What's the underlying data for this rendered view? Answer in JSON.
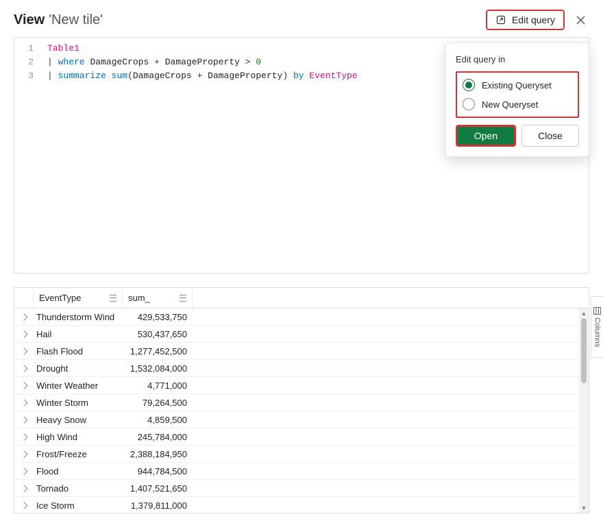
{
  "header": {
    "view_label": "View",
    "tile_name": "'New tile'",
    "edit_query_label": "Edit query"
  },
  "code": {
    "lines": [
      "1",
      "2",
      "3"
    ],
    "line1_table": "Table1",
    "line2_pipe": "|",
    "line2_where": "where",
    "line2_dc": "DamageCrops",
    "line2_plus": "+",
    "line2_dp": "DamageProperty",
    "line2_gt": ">",
    "line2_zero": "0",
    "line3_pipe": "|",
    "line3_summarize": "summarize",
    "line3_sum": "sum",
    "line3_open": "(",
    "line3_dc": "DamageCrops",
    "line3_plus": "+",
    "line3_dp": "DamageProperty",
    "line3_close": ")",
    "line3_by": "by",
    "line3_et": "EventType"
  },
  "popup": {
    "title": "Edit query in",
    "opt_existing": "Existing Queryset",
    "opt_new": "New Queryset",
    "open": "Open",
    "close": "Close"
  },
  "table": {
    "col_event": "EventType",
    "col_sum": "sum_",
    "columns_tab": "Columns",
    "rows": [
      {
        "event": "Thunderstorm Wind",
        "sum": "429,533,750"
      },
      {
        "event": "Hail",
        "sum": "530,437,650"
      },
      {
        "event": "Flash Flood",
        "sum": "1,277,452,500"
      },
      {
        "event": "Drought",
        "sum": "1,532,084,000"
      },
      {
        "event": "Winter Weather",
        "sum": "4,771,000"
      },
      {
        "event": "Winter Storm",
        "sum": "79,264,500"
      },
      {
        "event": "Heavy Snow",
        "sum": "4,859,500"
      },
      {
        "event": "High Wind",
        "sum": "245,784,000"
      },
      {
        "event": "Frost/Freeze",
        "sum": "2,388,184,950"
      },
      {
        "event": "Flood",
        "sum": "944,784,500"
      },
      {
        "event": "Tornado",
        "sum": "1,407,521,650"
      },
      {
        "event": "Ice Storm",
        "sum": "1,379,811,000"
      }
    ]
  }
}
